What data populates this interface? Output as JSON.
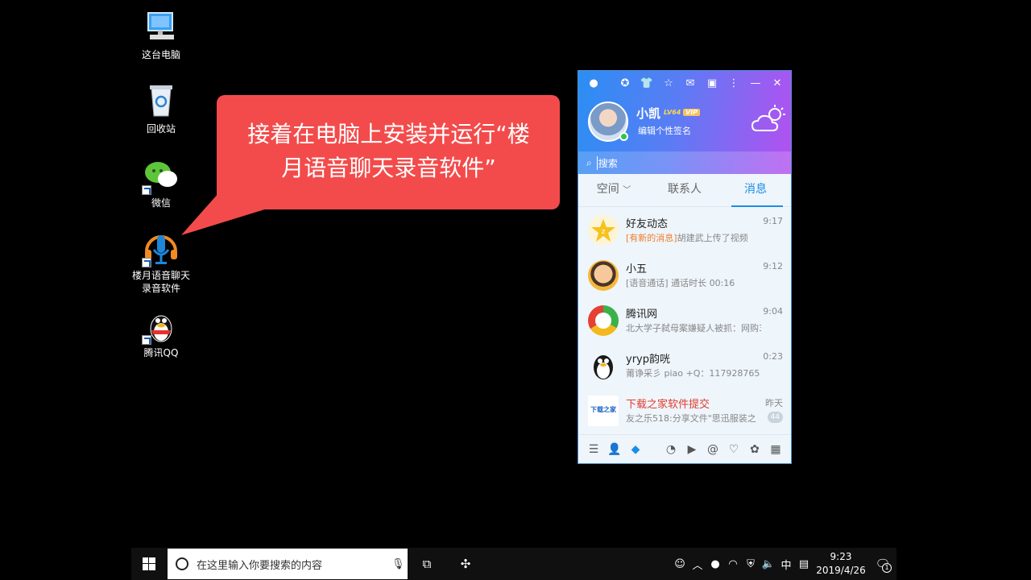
{
  "desktop": {
    "icons": [
      {
        "label_line1": "这台电脑",
        "label_line2": ""
      },
      {
        "label_line1": "回收站",
        "label_line2": ""
      },
      {
        "label_line1": "微信",
        "label_line2": ""
      },
      {
        "label_line1": "楼月语音聊天",
        "label_line2": "录音软件"
      },
      {
        "label_line1": "腾讯QQ",
        "label_line2": ""
      }
    ]
  },
  "callout": {
    "line1": "接着在电脑上安装并运行“楼",
    "line2": "月语音聊天录音软件”"
  },
  "qq": {
    "nickname": "小凯",
    "level": "LV64",
    "vip": "VIP",
    "signature": "编辑个性签名",
    "search_placeholder": "搜索",
    "tabs": [
      "空间",
      "联系人",
      "消息"
    ],
    "tab_space_arrow": "﹀",
    "messages": [
      {
        "name": "好友动态",
        "highlight": "[有新的消息]",
        "sub": "胡建武上传了视频",
        "time": "9:17",
        "badge": ""
      },
      {
        "name": "小五",
        "highlight": "",
        "sub": "[语音通话] 通话时长 00:16",
        "time": "9:12",
        "badge": ""
      },
      {
        "name": "腾讯网",
        "highlight": "",
        "sub": "北大学子弑母案嫌疑人被抓：网购30多",
        "time": "9:04",
        "badge": ""
      },
      {
        "name": "yryp韵咣",
        "highlight": "",
        "sub": "莆诤采彡 piao +Q：117928765",
        "time": "0:23",
        "badge": ""
      },
      {
        "name": "下载之家软件提交",
        "highlight": "",
        "sub": "友之乐518:分享文件\"思迅服装之",
        "time": "昨天",
        "badge": "44"
      }
    ],
    "logo_text": "下载之家"
  },
  "taskbar": {
    "search_placeholder": "在这里输入你要搜索的内容",
    "ime": "中",
    "time": "9:23",
    "date": "2019/4/26",
    "notif_count": "1"
  },
  "colors": {
    "callout": "#f34b4b",
    "qq_accent": "#1a8de6",
    "qq_header_start": "#2b8ef3",
    "qq_header_end": "#b550f0"
  }
}
